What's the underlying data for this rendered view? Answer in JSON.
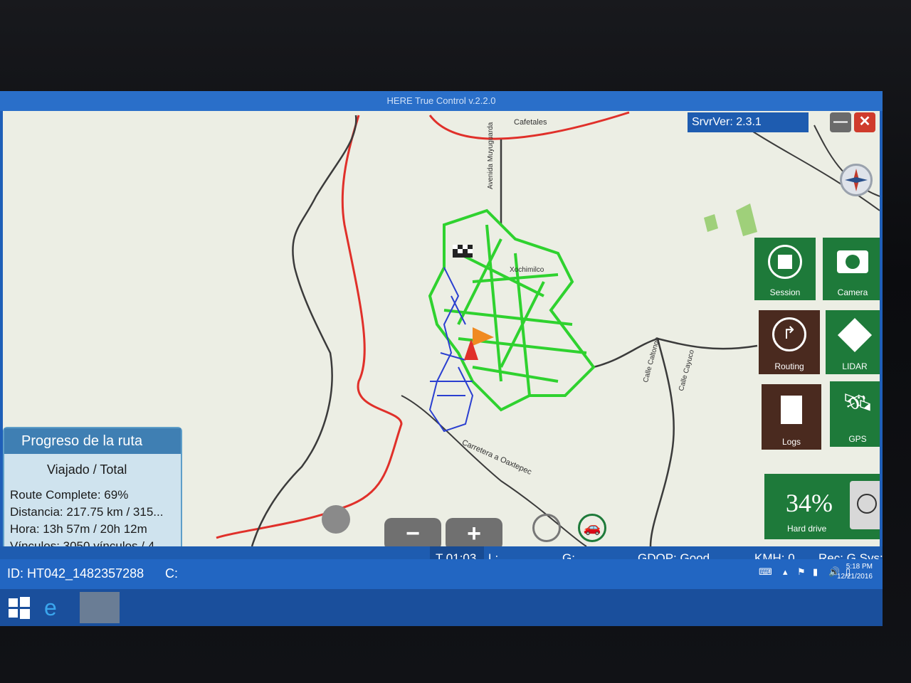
{
  "window": {
    "title": "HERE True Control v.2.2.0"
  },
  "server": {
    "version": "SrvrVer: 2.3.1"
  },
  "map": {
    "labels": {
      "top": "Cafetales",
      "avenue": "Avenida Muyuguarda",
      "district": "Xochimilco",
      "road": "Carretera a Oaxtepec",
      "street1": "Calle Caltongo",
      "street2": "Calle Cayuco"
    }
  },
  "side_tiles": [
    {
      "label": "Session"
    },
    {
      "label": "Camera"
    },
    {
      "label": "Routing"
    },
    {
      "label": "LIDAR"
    },
    {
      "label": "Logs"
    },
    {
      "label": "GPS"
    }
  ],
  "harddrive": {
    "percent": "34%",
    "label": "Hard drive"
  },
  "progress": {
    "title": "Progreso de la ruta",
    "subtitle": "Viajado / Total",
    "route_complete": "Route Complete: 69%",
    "distancia": "Distancia: 217.75 km / 315...",
    "hora": "Hora: 13h 57m / 20h 12m",
    "vinculos": "Vínculos: 3050 vínculos / 4..."
  },
  "zoom": {
    "out": "−",
    "in": "+"
  },
  "status": {
    "time": "T 01:03",
    "l": "L:",
    "g": "G:",
    "gdop": "GDOP: Good",
    "kmh": "KMH: 0",
    "recsys": "Rec: G  Sys: G"
  },
  "id_bar": {
    "id": "ID: HT042_1482357288",
    "c": "C:"
  },
  "taskbar": {
    "time": "5:18 PM",
    "date": "12/21/2016"
  },
  "colors": {
    "accent_green": "#1e7a3a",
    "accent_brown": "#4a2a1f",
    "route_red": "#e0302a",
    "coverage_green": "#2fd22f",
    "coverage_blue": "#2a3fd0"
  }
}
